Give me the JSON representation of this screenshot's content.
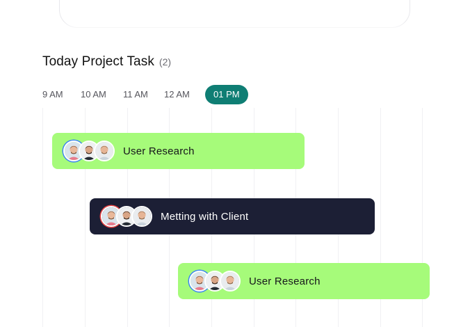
{
  "header": {
    "title": "Today Project Task",
    "count": "(2)"
  },
  "timeline": {
    "slots": [
      "9 AM",
      "10 AM",
      "11 AM",
      "12 AM",
      "01 PM"
    ],
    "active_slot": "01 PM",
    "accent_color": "#0f7e74"
  },
  "tasks": [
    {
      "label": "User Research",
      "color": "#a6fb7a",
      "avatars": [
        "avatar-man-pink",
        "avatar-man-dark",
        "avatar-man-light"
      ]
    },
    {
      "label": "Metting with Client",
      "color": "#1c1f35",
      "avatars": [
        "avatar-man-pink",
        "avatar-man-dark",
        "avatar-man-light"
      ]
    },
    {
      "label": "User Research",
      "color": "#a6fb7a",
      "avatars": [
        "avatar-man-pink",
        "avatar-man-dark",
        "avatar-man-light"
      ]
    }
  ]
}
